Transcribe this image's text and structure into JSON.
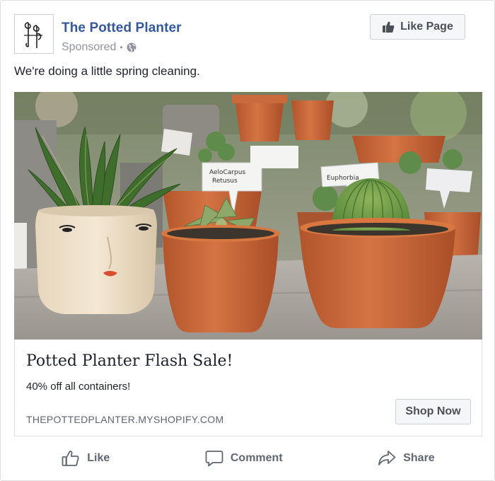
{
  "header": {
    "page_name": "The Potted Planter",
    "sponsored_label": "Sponsored",
    "separator": "•",
    "like_page_label": "Like Page",
    "logo_monogram": "ᵽp"
  },
  "post": {
    "text": "We're doing a little spring cleaning."
  },
  "image": {
    "plant_tags": [
      "AeloCarpus Retusus",
      "Euphorbia"
    ]
  },
  "ad": {
    "title": "Potted Planter Flash Sale!",
    "description": "40% off all containers!",
    "url": "THEPOTTEDPLANTER.MYSHOPIFY.COM",
    "cta_label": "Shop Now"
  },
  "actions": {
    "like_label": "Like",
    "comment_label": "Comment",
    "share_label": "Share"
  },
  "colors": {
    "page_name": "#365899",
    "muted_text": "#90949c",
    "button_text": "#4b4f56",
    "terracotta": "#c8663a"
  }
}
